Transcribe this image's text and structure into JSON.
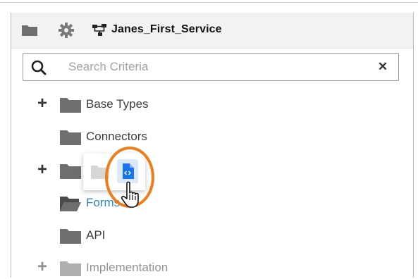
{
  "toolbar": {
    "folder_button_icon": "folder-icon",
    "settings_button_icon": "gear-icon",
    "service_icon": "service-icon",
    "service_name": "Janes_First_Service"
  },
  "search": {
    "placeholder": "Search Criteria",
    "value": "",
    "search_icon": "search-icon",
    "clear_icon": "close-icon",
    "clear_glyph": "✕"
  },
  "tree": {
    "expand_glyph": "+",
    "items": [
      {
        "label": "Base Types",
        "expandable": true
      },
      {
        "label": "Connectors",
        "expandable": false
      },
      {
        "label": "",
        "expandable": true
      },
      {
        "label": "Forms",
        "expandable": false,
        "open": true
      },
      {
        "label": "API",
        "expandable": false
      },
      {
        "label": "Implementation",
        "expandable": true
      }
    ]
  },
  "drag_preview": {
    "ghost_icon": "folder-icon",
    "file_icon": "code-file-icon"
  },
  "cursor": {
    "icon": "hand-pointer-icon"
  },
  "colors": {
    "toolbar_bg": "#f2f2f2",
    "folder_gray": "#6e6e6e",
    "link_blue": "#2f86c8",
    "highlight_orange": "#ef7d1a",
    "file_blue": "#1a73e8"
  }
}
